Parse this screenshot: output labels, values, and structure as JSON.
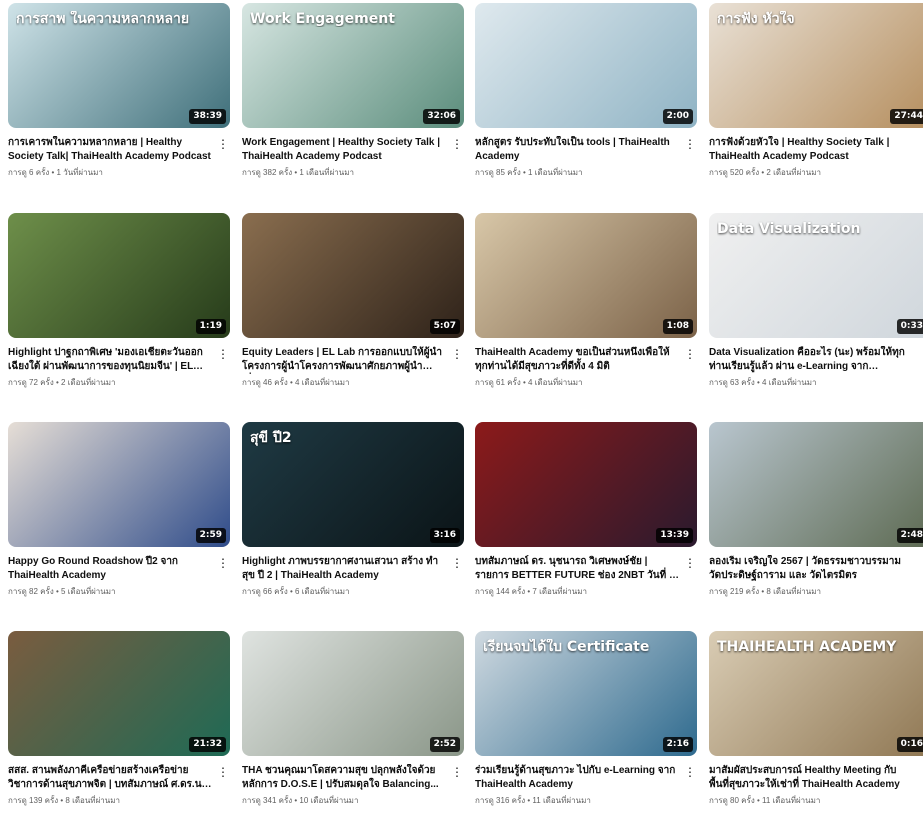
{
  "videos": [
    {
      "caption": "การสาพ ในความหลากหลาย",
      "duration": "38:39",
      "title": "การเคารพในความหลากหลาย | Healthy Society Talk| ThaiHealth Academy Podcast",
      "stats": "การดู 6 ครั้ง • 1 วันที่ผ่านมา",
      "colors": [
        "#cfe3e8",
        "#3f6f7a"
      ]
    },
    {
      "caption": "Work Engagement",
      "duration": "32:06",
      "title": "Work Engagement | Healthy Society Talk | ThaiHealth Academy Podcast",
      "stats": "การดู 382 ครั้ง • 1 เดือนที่ผ่านมา",
      "colors": [
        "#d7e6e2",
        "#5b8d7c"
      ]
    },
    {
      "caption": "",
      "duration": "2:00",
      "title": "หลักสูตร รับประทับใจเป็น tools | ThaiHealth Academy",
      "stats": "การดู 85 ครั้ง • 1 เดือนที่ผ่านมา",
      "colors": [
        "#dfe9ee",
        "#8fb3c4"
      ]
    },
    {
      "caption": "การฟัง หัวใจ",
      "duration": "27:44",
      "title": "การฟังด้วยหัวใจ | Healthy Society Talk | ThaiHealth Academy Podcast",
      "stats": "การดู 520 ครั้ง • 2 เดือนที่ผ่านมา",
      "colors": [
        "#e9e1d6",
        "#b58e5e"
      ]
    },
    {
      "caption": "",
      "duration": "1:19",
      "title": "Highlight ปาฐกถาพิเศษ 'มองเอเชียตะวันออกเฉียงใต้ ผ่านพัฒนาการของทุนนิยมจีน' | EL รุ่น...",
      "stats": "การดู 72 ครั้ง • 2 เดือนที่ผ่านมา",
      "colors": [
        "#6e8f4a",
        "#263b1a"
      ]
    },
    {
      "caption": "",
      "duration": "5:07",
      "title": "Equity Leaders | EL Lab การออกแบบให้ผู้นำ โครงการผู้นำโครงการพัฒนาศักยภาพผู้นำเพื่อ...",
      "stats": "การดู 46 ครั้ง • 4 เดือนที่ผ่านมา",
      "colors": [
        "#8a6e4f",
        "#2e2219"
      ]
    },
    {
      "caption": "",
      "duration": "1:08",
      "title": "ThaiHealth Academy ขอเป็นส่วนหนึ่งเพื่อให้ทุกท่านได้มีสุขภาวะที่ดีทั้ง 4 มิติ",
      "stats": "การดู 61 ครั้ง • 4 เดือนที่ผ่านมา",
      "colors": [
        "#d8c7a8",
        "#7b6248"
      ]
    },
    {
      "caption": "Data Visualization",
      "duration": "0:33",
      "title": "Data Visualization คืออะไร (นะ) พร้อมให้ทุกท่านเรียนรู้แล้ว ผ่าน e-Learning จาก ThaiHealt...",
      "stats": "การดู 63 ครั้ง • 4 เดือนที่ผ่านมา",
      "colors": [
        "#f0f0f0",
        "#cfd6dc"
      ]
    },
    {
      "caption": "",
      "duration": "2:59",
      "title": "Happy Go Round Roadshow ปี2 จาก ThaiHealth Academy",
      "stats": "การดู 82 ครั้ง • 5 เดือนที่ผ่านมา",
      "colors": [
        "#e6ded6",
        "#2f4c8a"
      ]
    },
    {
      "caption": "สุขี ปี2",
      "duration": "3:16",
      "title": "Highlight ภาพบรรยากาศงานเสวนา สร้าง ทำ สุข ปี 2 | ThaiHealth Academy",
      "stats": "การดู 66 ครั้ง • 6 เดือนที่ผ่านมา",
      "colors": [
        "#1f3a44",
        "#0b1417"
      ]
    },
    {
      "caption": "",
      "duration": "13:39",
      "title": "บทสัมภาษณ์ ดร. นุชนารถ วิเศษพงษ์ชัย | รายการ BETTER FUTURE ช่อง 2NBT วันที่ 3 พฤษภาคม...",
      "stats": "การดู 144 ครั้ง • 7 เดือนที่ผ่านมา",
      "colors": [
        "#8c1a1a",
        "#2a1a2e"
      ]
    },
    {
      "caption": "",
      "duration": "2:48",
      "title": "ลองเริ่ม เจริญใจ 2567 | วัดธรรมชาวบรรมาม วัดประดิษฐ์ถาราม และ วัดไตรมิตร",
      "stats": "การดู 219 ครั้ง • 8 เดือนที่ผ่านมา",
      "colors": [
        "#b9c6cf",
        "#5d6a52"
      ]
    },
    {
      "caption": "",
      "duration": "21:32",
      "title": "สสส. สานพลังภาคีเครือข่ายสร้างเครือข่ายวิชาการด้านสุขภาพจิต | บทสัมภาษณ์ ศ.ดร.นพ. นันทชัย...",
      "stats": "การดู 139 ครั้ง • 8 เดือนที่ผ่านมา",
      "colors": [
        "#7a5c3f",
        "#1e6a55"
      ]
    },
    {
      "caption": "",
      "duration": "2:52",
      "title": "THA ชวนคุณมาโดสความสุข ปลุกพลังใจด้วยหลักการ D.O.S.E | ปรับสมดุลใจ Balancing...",
      "stats": "การดู 341 ครั้ง • 10 เดือนที่ผ่านมา",
      "colors": [
        "#dfe3e0",
        "#8a9688"
      ]
    },
    {
      "caption": "เรียนจบได้ใบ Certificate",
      "duration": "2:16",
      "title": "ร่วมเรียนรู้ด้านสุขภาวะ ไปกับ e-Learning จาก ThaiHealth Academy",
      "stats": "การดู 316 ครั้ง • 11 เดือนที่ผ่านมา",
      "colors": [
        "#cfd9e0",
        "#2e6a8e"
      ]
    },
    {
      "caption": "THAIHEALTH ACADEMY",
      "duration": "0:16",
      "title": "มาสัมผัสประสบการณ์ Healthy Meeting กับพื้นที่สุขภาวะให้เช่าที่ ThaiHealth Academy",
      "stats": "การดู 80 ครั้ง • 11 เดือนที่ผ่านมา",
      "colors": [
        "#d9ccb4",
        "#8f7753"
      ]
    }
  ]
}
